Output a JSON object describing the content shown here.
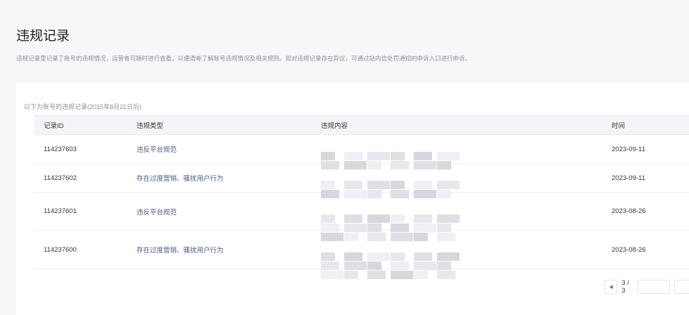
{
  "page": {
    "title": "违规记录",
    "description": "违规记录里记录了账号的违规情况，运营者可随时进行查看，以便清晰了解账号违规情况及相关规则。如对违规记录存在异议，可通过站内信处罚通知的申诉入口进行申诉。"
  },
  "records": {
    "subtitle": "以下为账号的违规记录(2015年8月21日后)",
    "columns": [
      "记录ID",
      "违规类型",
      "违规内容",
      "时间"
    ],
    "rows": [
      {
        "id": "114237603",
        "type": "违反平台规范",
        "time": "2023-09-11"
      },
      {
        "id": "114237602",
        "type": "存在过度营销、骚扰用户行为",
        "time": "2023-09-11"
      },
      {
        "id": "114237601",
        "type": "违反平台规范",
        "time": "2023-08-26"
      },
      {
        "id": "114237600",
        "type": "存在过度营销、骚扰用户行为",
        "time": "2023-08-26"
      }
    ]
  },
  "pager": {
    "label": "3 / 3",
    "prev_icon": "caret-left-icon"
  }
}
